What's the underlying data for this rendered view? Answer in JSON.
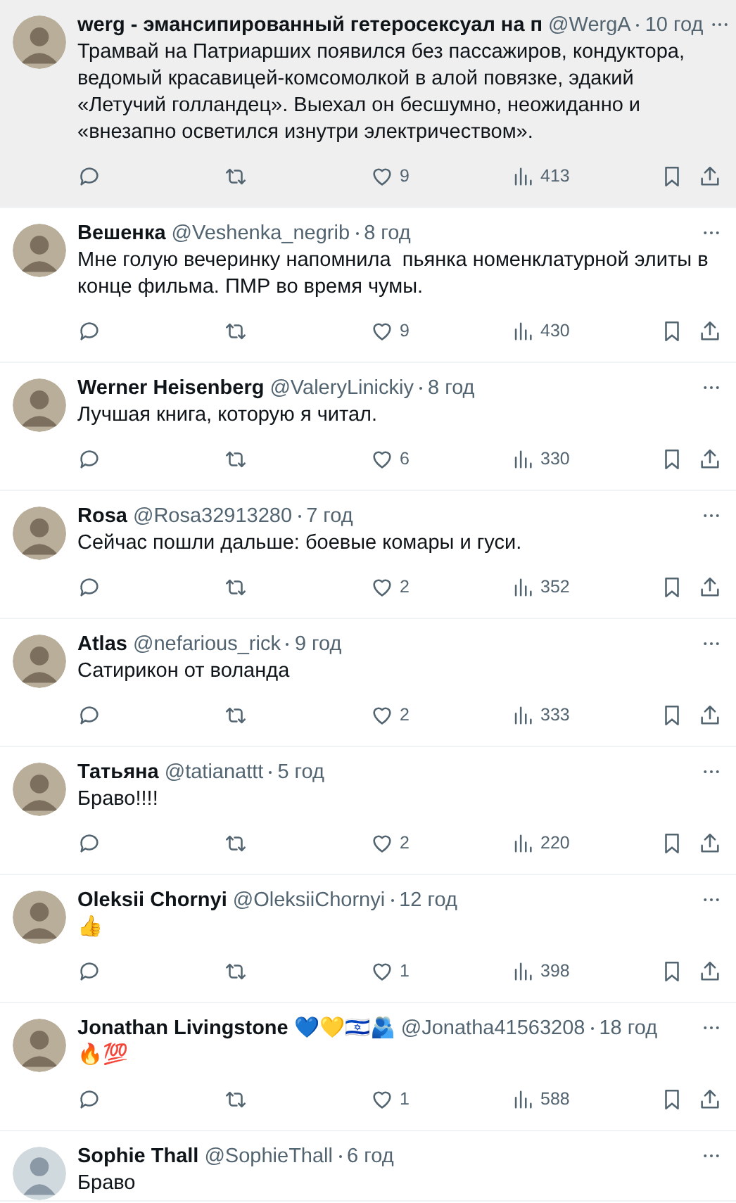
{
  "replies": [
    {
      "avatar": {
        "kind": "photo"
      },
      "name": "werg - эмансипированный гетеросексуал на п",
      "handle": "@WergA",
      "time": "10 год",
      "highlighted": true,
      "text": "Трамвай на Патриарших появился без пассажиров, кондуктора, ведомый красавицей-комсомолкой в алой повязке, эдакий «Летучий голландец». Выехал он бесшумно, неожиданно и «внезапно осветился изнутри электричеством».",
      "likes": "9",
      "views": "413"
    },
    {
      "avatar": {
        "kind": "photo"
      },
      "name": "Вешенка",
      "handle": "@Veshenka_negrib",
      "time": "8 год",
      "highlighted": false,
      "text": "Мне голую вечеринку напомнила  пьянка номенклатурной элиты в конце фильма. ПМР во время чумы.",
      "likes": "9",
      "views": "430"
    },
    {
      "avatar": {
        "kind": "photo"
      },
      "name": "Werner Heisenberg",
      "handle": "@ValeryLinickiy",
      "time": "8 год",
      "highlighted": false,
      "text": "Лучшая книга, которую я читал.",
      "likes": "6",
      "views": "330"
    },
    {
      "avatar": {
        "kind": "photo"
      },
      "name": "Rosa",
      "handle": "@Rosa32913280",
      "time": "7 год",
      "highlighted": false,
      "text": "Сейчас пошли дальше: боевые комары и гуси.",
      "likes": "2",
      "views": "352"
    },
    {
      "avatar": {
        "kind": "photo"
      },
      "name": "Atlas",
      "handle": "@nefarious_rick",
      "time": "9 год",
      "highlighted": false,
      "text": "Сатирикон от воланда",
      "likes": "2",
      "views": "333"
    },
    {
      "avatar": {
        "kind": "photo"
      },
      "name": "Татьяна",
      "handle": "@tatianattt",
      "time": "5 год",
      "highlighted": false,
      "text": "Браво!!!!",
      "likes": "2",
      "views": "220"
    },
    {
      "avatar": {
        "kind": "photo"
      },
      "name": "Oleksii Chornyi",
      "handle": "@OleksiiChornyi",
      "time": "12 год",
      "highlighted": false,
      "text": "👍",
      "likes": "1",
      "views": "398"
    },
    {
      "avatar": {
        "kind": "photo"
      },
      "name": "Jonathan Livingstone 💙💛🇮🇱🫂",
      "handle": "@Jonatha41563208",
      "time": "18 год",
      "highlighted": false,
      "text": "🔥💯",
      "likes": "1",
      "views": "588"
    },
    {
      "avatar": {
        "kind": "default"
      },
      "name": "Sophie Thall",
      "handle": "@SophieThall",
      "time": "6 год",
      "highlighted": false,
      "text": "Браво"
    }
  ]
}
